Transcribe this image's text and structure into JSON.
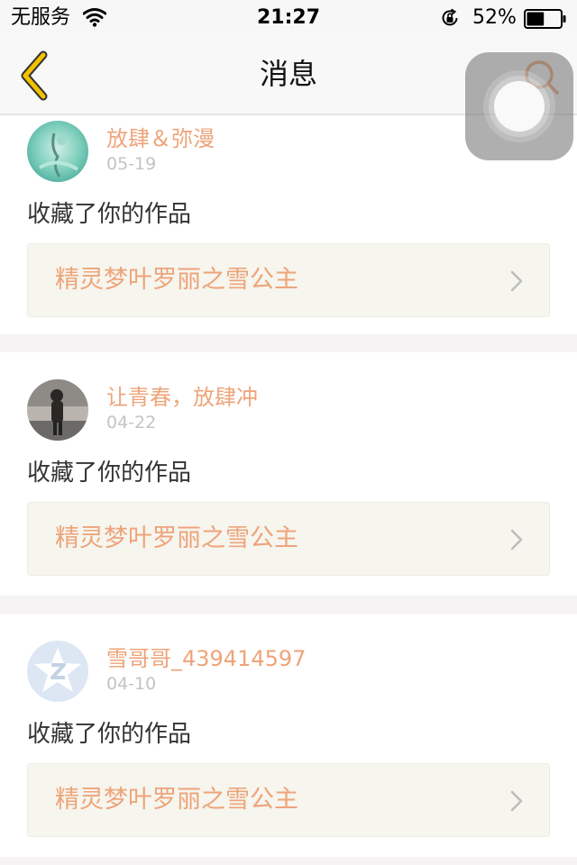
{
  "status_bar": {
    "carrier": "无服务",
    "time": "21:27",
    "battery_percent": "52%",
    "battery_level": 0.52
  },
  "nav": {
    "title": "消息",
    "back_icon": "chevron-left-icon",
    "search_icon": "search-icon"
  },
  "colors": {
    "accent": "#eea47a",
    "back_icon": "#f2c200",
    "work_link_bg": "#f6f5ee"
  },
  "messages": [
    {
      "user": "放肆＆弥漫",
      "date": "05-19",
      "action": "收藏了你的作品",
      "work_title": "精灵梦叶罗丽之雪公主"
    },
    {
      "user": "让青春，放肆冲",
      "date": "04-22",
      "action": "收藏了你的作品",
      "work_title": "精灵梦叶罗丽之雪公主"
    },
    {
      "user": "雪哥哥_439414597",
      "date": "04-10",
      "action": "收藏了你的作品",
      "work_title": "精灵梦叶罗丽之雪公主"
    }
  ]
}
